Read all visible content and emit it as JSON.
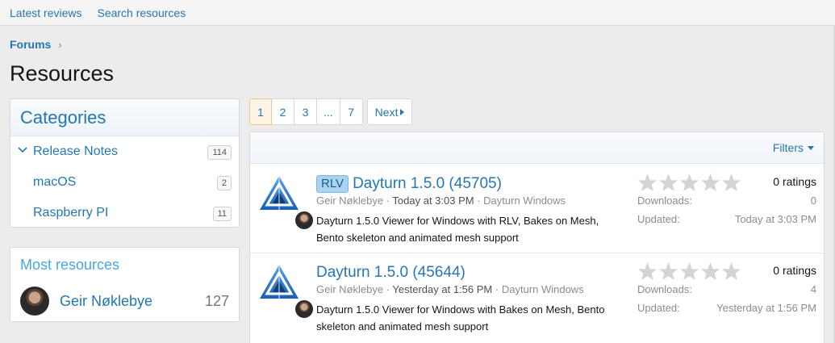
{
  "nav": {
    "latest_reviews": "Latest reviews",
    "search_resources": "Search resources"
  },
  "breadcrumb": {
    "forums": "Forums"
  },
  "page_title": "Resources",
  "categories": {
    "title": "Categories",
    "items": [
      {
        "label": "Release Notes",
        "count": "114",
        "expanded": true
      },
      {
        "label": "macOS",
        "count": "2"
      },
      {
        "label": "Raspberry PI",
        "count": "11"
      }
    ]
  },
  "most_resources": {
    "title": "Most resources",
    "user": "Geir Nøklebye",
    "count": "127"
  },
  "pager": {
    "pages": [
      "1",
      "2",
      "3",
      "...",
      "7"
    ],
    "current": "1",
    "next": "Next"
  },
  "filters": "Filters",
  "resources": [
    {
      "prefix": "RLV",
      "title": "Dayturn 1.5.0 (45705)",
      "author": "Geir Nøklebye",
      "time": "Today at 3:03 PM",
      "category": "Dayturn Windows",
      "description": "Dayturn 1.5.0 Viewer for Windows with RLV, Bakes on Mesh, Bento skeleton and animated mesh support",
      "ratings": "0 ratings",
      "downloads_label": "Downloads:",
      "downloads": "0",
      "updated_label": "Updated:",
      "updated": "Today at 3:03 PM",
      "stars_filled": 0
    },
    {
      "prefix": "",
      "title": "Dayturn 1.5.0 (45644)",
      "author": "Geir Nøklebye",
      "time": "Yesterday at 1:56 PM",
      "category": "Dayturn Windows",
      "description": "Dayturn 1.5.0 Viewer for Windows with Bakes on Mesh, Bento skeleton and animated mesh support",
      "ratings": "0 ratings",
      "downloads_label": "Downloads:",
      "downloads": "4",
      "updated_label": "Updated:",
      "updated": "Yesterday at 1:56 PM",
      "stars_filled": 0
    }
  ],
  "colors": {
    "link": "#2577b1",
    "prefix_bg": "#aad2f1",
    "current_page_bg": "#fef4e6",
    "star_empty": "#d4d4d4"
  }
}
